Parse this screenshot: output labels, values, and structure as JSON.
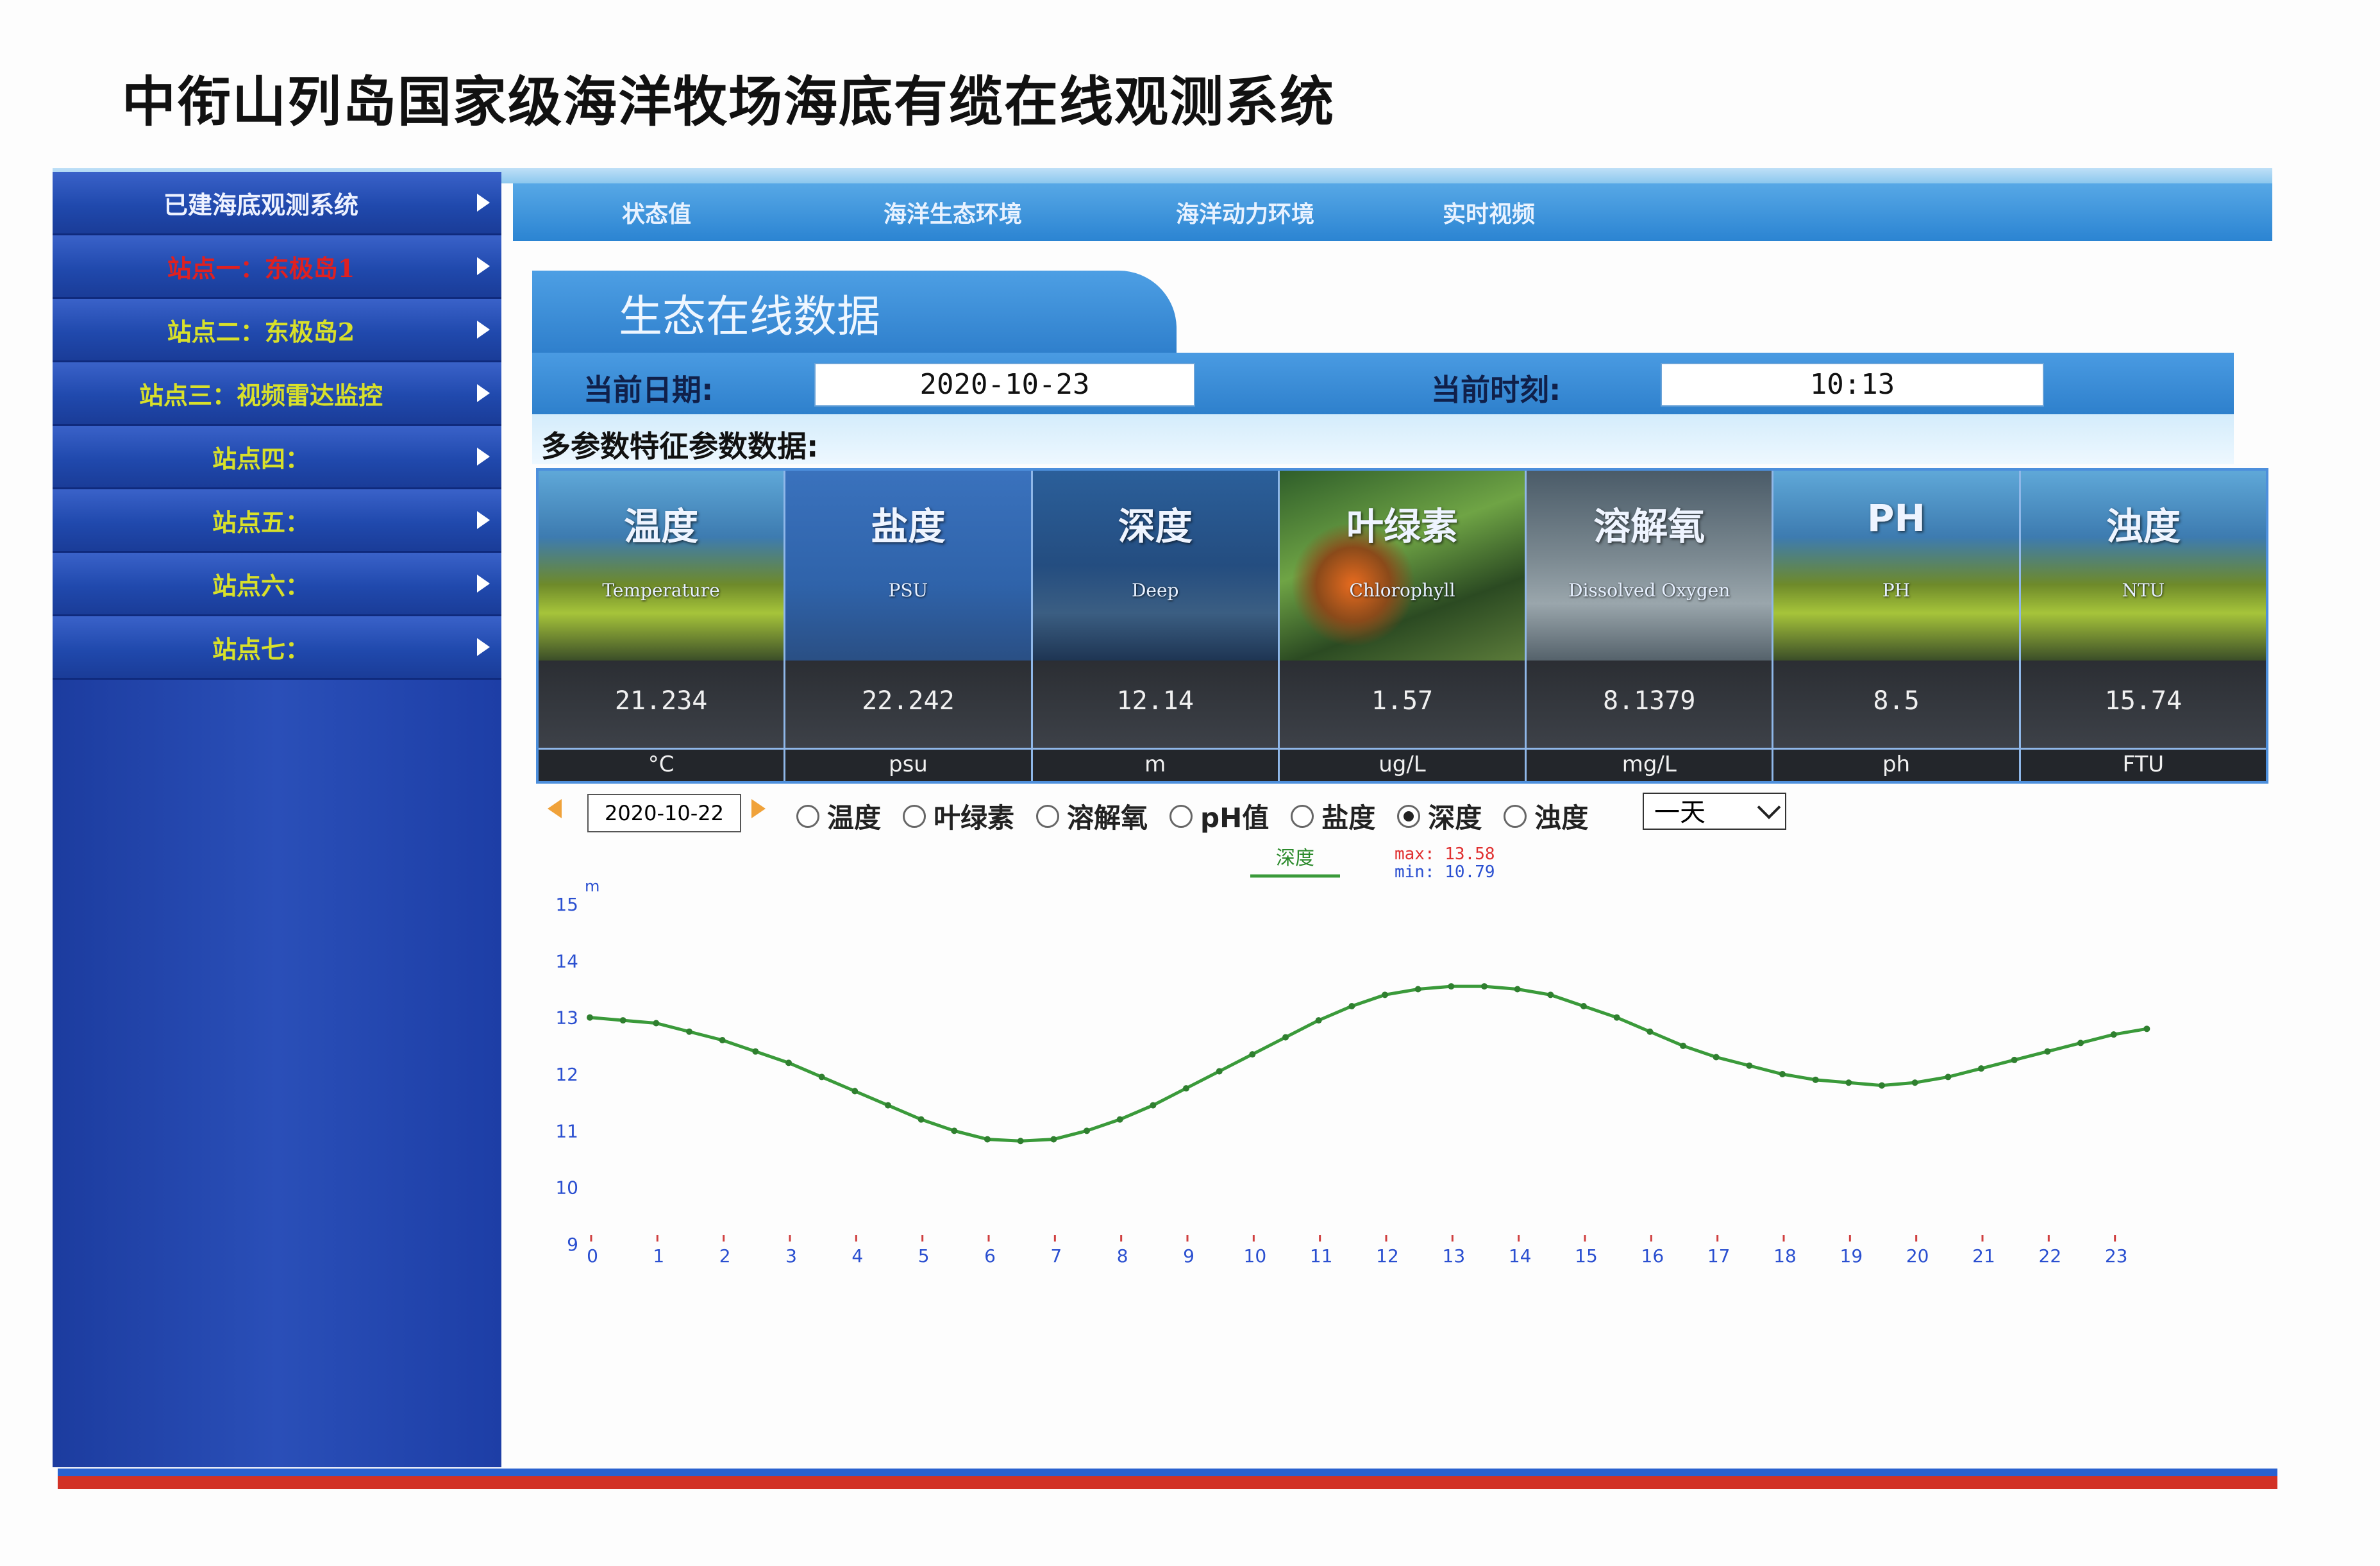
{
  "page_title": "中衔山列岛国家级海洋牧场海底有缆在线观测系统",
  "sidebar": {
    "items": [
      {
        "label": "已建海底观测系统",
        "state": "header"
      },
      {
        "label": "站点一：东极岛1",
        "state": "active"
      },
      {
        "label": "站点二：东极岛2",
        "state": "normal"
      },
      {
        "label": "站点三：视频雷达监控",
        "state": "normal"
      },
      {
        "label": "站点四：",
        "state": "normal"
      },
      {
        "label": "站点五：",
        "state": "normal"
      },
      {
        "label": "站点六：",
        "state": "normal"
      },
      {
        "label": "站点七：",
        "state": "normal"
      }
    ]
  },
  "nav": {
    "tabs": [
      "状态值",
      "海洋生态环境",
      "海洋动力环境",
      "实时视频"
    ]
  },
  "section": {
    "title": "生态在线数据",
    "date_label": "当前日期:",
    "date_value": "2020-10-23",
    "time_label": "当前时刻:",
    "time_value": "10:13",
    "multi_label": "多参数特征参数数据:"
  },
  "params": [
    {
      "name": "温度",
      "en": "Temperature",
      "value": "21.234",
      "unit": "°C"
    },
    {
      "name": "盐度",
      "en": "PSU",
      "value": "22.242",
      "unit": "psu"
    },
    {
      "name": "深度",
      "en": "Deep",
      "value": "12.14",
      "unit": "m"
    },
    {
      "name": "叶绿素",
      "en": "Chlorophyll",
      "value": "1.57",
      "unit": "ug/L"
    },
    {
      "name": "溶解氧",
      "en": "Dissolved Oxygen",
      "value": "8.1379",
      "unit": "mg/L"
    },
    {
      "name": "PH",
      "en": "PH",
      "value": "8.5",
      "unit": "ph"
    },
    {
      "name": "浊度",
      "en": "NTU",
      "value": "15.74",
      "unit": "FTU"
    }
  ],
  "controls": {
    "date": "2020-10-22",
    "radios": [
      {
        "label": "温度",
        "checked": false
      },
      {
        "label": "叶绿素",
        "checked": false
      },
      {
        "label": "溶解氧",
        "checked": false
      },
      {
        "label": "pH值",
        "checked": false
      },
      {
        "label": "盐度",
        "checked": false
      },
      {
        "label": "深度",
        "checked": true
      },
      {
        "label": "浊度",
        "checked": false
      }
    ],
    "range_select": "一天"
  },
  "chart_data": {
    "type": "line",
    "legend": "深度",
    "max_label": "max: 13.58",
    "min_label": "min: 10.79",
    "ylabel": "m",
    "ylim": [
      9,
      15
    ],
    "yticks": [
      9,
      10,
      11,
      12,
      13,
      14,
      15
    ],
    "xlim": [
      0,
      24
    ],
    "xticks": [
      0,
      1,
      2,
      3,
      4,
      5,
      6,
      7,
      8,
      9,
      10,
      11,
      12,
      13,
      14,
      15,
      16,
      17,
      18,
      19,
      20,
      21,
      22,
      23
    ],
    "series": [
      {
        "name": "深度",
        "color": "#3a9a3a",
        "x": [
          0,
          0.5,
          1,
          1.5,
          2,
          2.5,
          3,
          3.5,
          4,
          4.5,
          5,
          5.5,
          6,
          6.5,
          7,
          7.5,
          8,
          8.5,
          9,
          9.5,
          10,
          10.5,
          11,
          11.5,
          12,
          12.5,
          13,
          13.5,
          14,
          14.5,
          15,
          15.5,
          16,
          16.5,
          17,
          17.5,
          18,
          18.5,
          19,
          19.5,
          20,
          20.5,
          21,
          21.5,
          22,
          22.5,
          23,
          23.5
        ],
        "y": [
          13.0,
          12.95,
          12.9,
          12.75,
          12.6,
          12.4,
          12.2,
          11.95,
          11.7,
          11.45,
          11.2,
          11.0,
          10.85,
          10.82,
          10.85,
          11.0,
          11.2,
          11.45,
          11.75,
          12.05,
          12.35,
          12.65,
          12.95,
          13.2,
          13.4,
          13.5,
          13.55,
          13.55,
          13.5,
          13.4,
          13.2,
          13.0,
          12.75,
          12.5,
          12.3,
          12.15,
          12.0,
          11.9,
          11.85,
          11.8,
          11.85,
          11.95,
          12.1,
          12.25,
          12.4,
          12.55,
          12.7,
          12.8
        ]
      }
    ]
  }
}
